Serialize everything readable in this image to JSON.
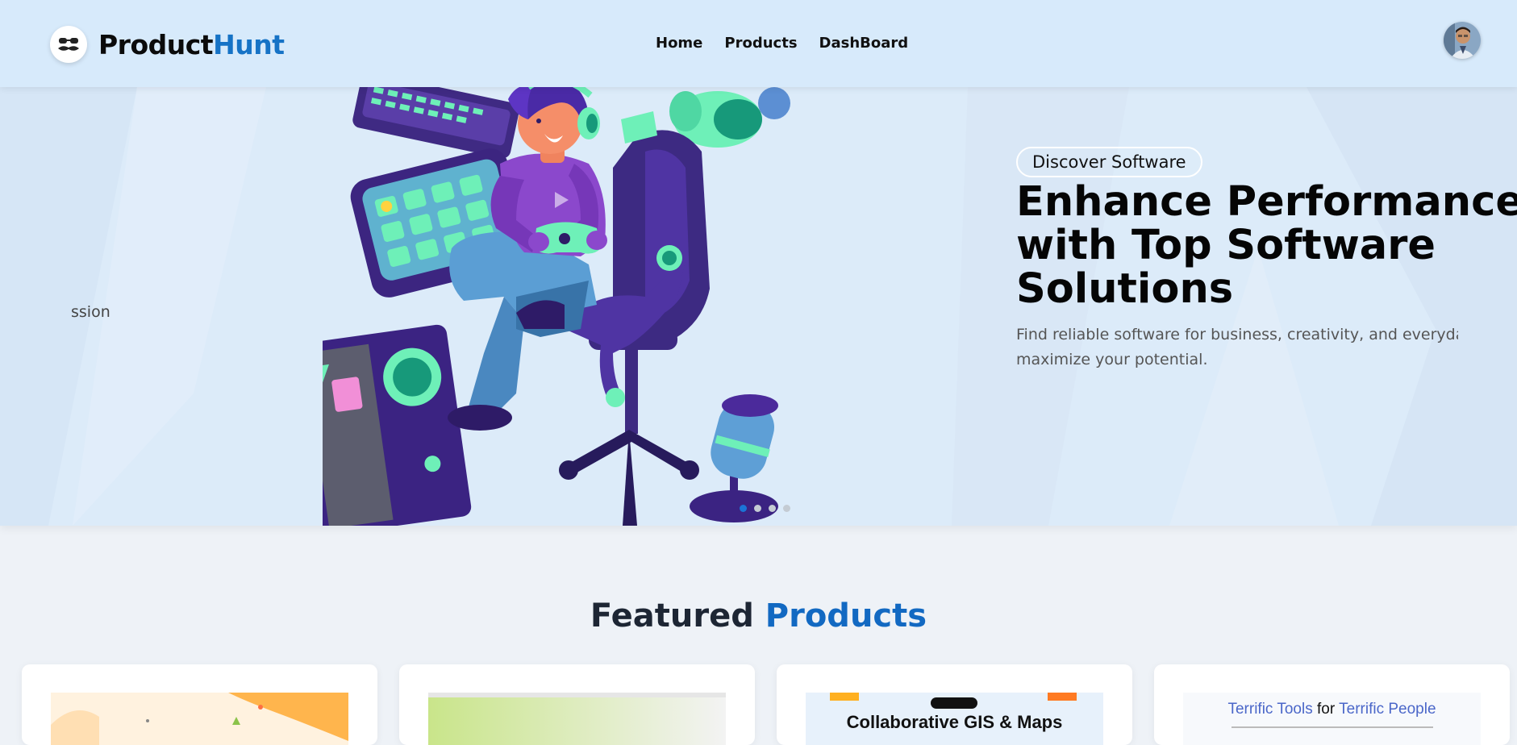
{
  "header": {
    "brand_part1": "Product",
    "brand_part2": "Hunt",
    "nav": [
      "Home",
      "Products",
      "DashBoard"
    ],
    "logo_icon": "mustache-glasses-icon",
    "avatar_icon": "user-avatar"
  },
  "hero": {
    "prev_slide_fragment": "ssion",
    "badge": "Discover Software",
    "title_lines": [
      "Enhance Performance",
      "with Top Software",
      "Solutions"
    ],
    "description_lines": [
      "Find reliable software for business, creativity, and everyday tas",
      "maximize your potential."
    ],
    "carousel": {
      "slides": 4,
      "active": 0
    }
  },
  "featured": {
    "title_part1": "Featured",
    "title_part2": "Products",
    "cards": [
      {
        "thumb_text": ""
      },
      {
        "thumb_text": ""
      },
      {
        "thumb_text": "Collaborative GIS & Maps"
      },
      {
        "thumb_part1": "Terrific Tools",
        "thumb_part2": "for",
        "thumb_part3": "Terrific People"
      }
    ]
  },
  "colors": {
    "header_bg": "#d7eafb",
    "hero_bg": "#dcebf9",
    "page_bg": "#eef2f7",
    "brand_accent": "#1673c6",
    "title_accent": "#1269c2",
    "dot_active": "#1b74d6"
  }
}
